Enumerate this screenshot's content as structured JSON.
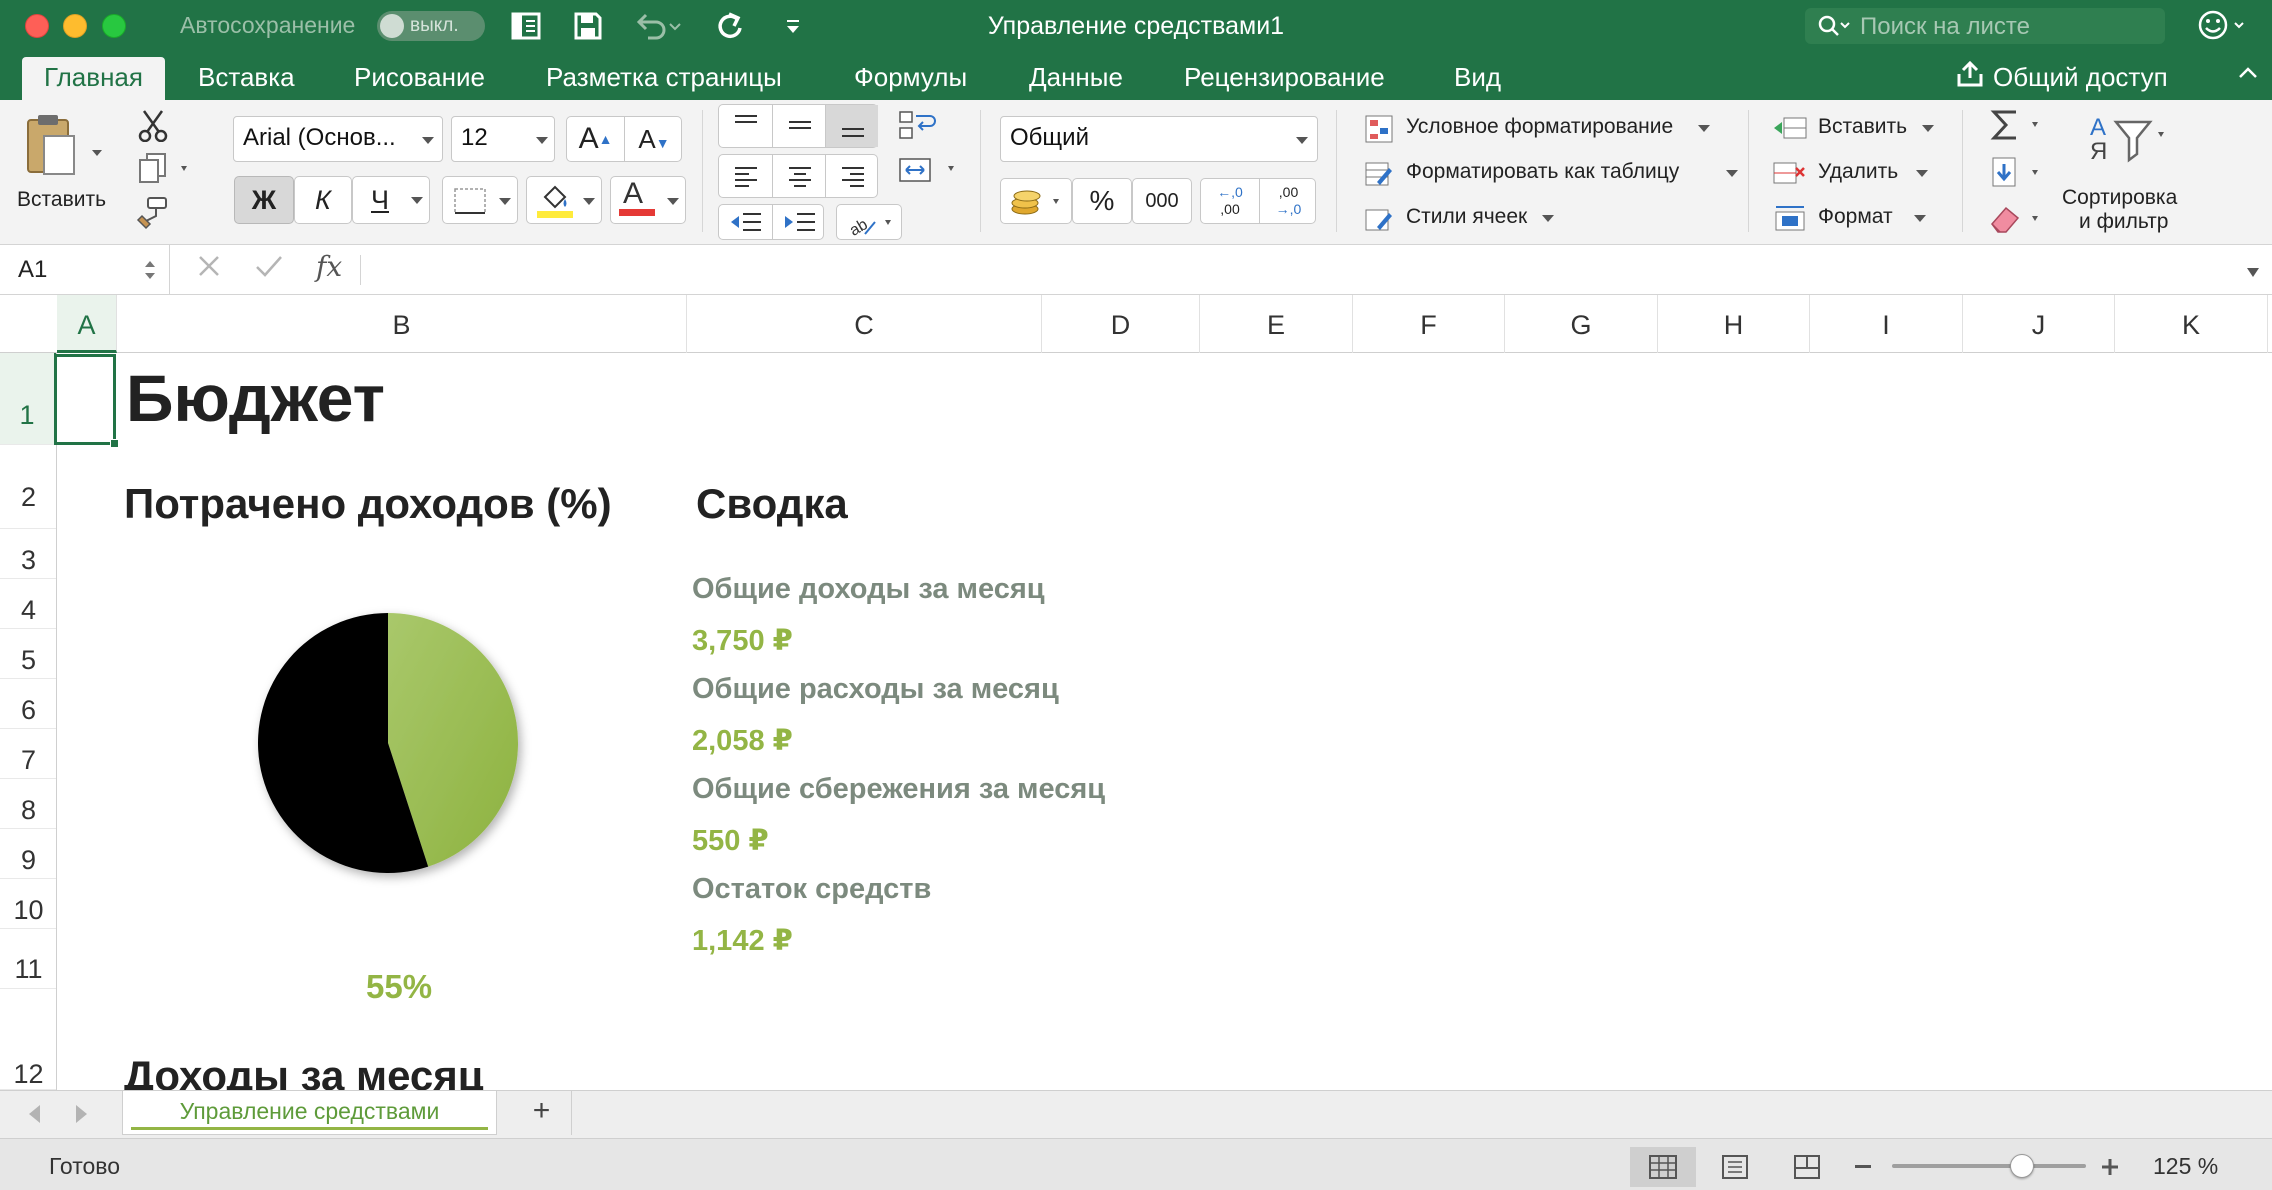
{
  "titlebar": {
    "autosave_label": "Автосохранение",
    "autosave_state": "выкл.",
    "window_title": "Управление средствами1",
    "search_placeholder": "Поиск на листе"
  },
  "ribbon_tabs": [
    "Главная",
    "Вставка",
    "Рисование",
    "Разметка страницы",
    "Формулы",
    "Данные",
    "Рецензирование",
    "Вид"
  ],
  "share_label": "Общий доступ",
  "ribbon": {
    "paste_label": "Вставить",
    "font_name": "Arial (Основ...",
    "font_size": "12",
    "bold_label": "Ж",
    "italic_label": "К",
    "underline_label": "Ч",
    "grow_font": "A",
    "shrink_font": "A",
    "font_color_letter": "A",
    "number_format": "Общий",
    "percent_symbol": "%",
    "thousands_label": "000",
    "dec_increase_top": "←,0",
    "dec_increase_bottom": ",00",
    "dec_decrease_top": ",00",
    "dec_decrease_bottom": "→,0",
    "conditional_formatting": "Условное форматирование",
    "format_as_table": "Форматировать как таблицу",
    "cell_styles": "Стили ячеек",
    "insert_cells": "Вставить",
    "delete_cells": "Удалить",
    "format_cells": "Формат",
    "sort_filter_line1": "Сортировка",
    "sort_filter_line2": "и фильтр",
    "sort_az_top": "А",
    "sort_az_bottom": "Я",
    "highlight_color": "#ffeb3b",
    "font_color": "#e53935"
  },
  "formula_bar": {
    "cell_ref": "A1",
    "fx_label": "fx",
    "formula": ""
  },
  "columns": [
    "A",
    "B",
    "C",
    "D",
    "E",
    "F",
    "G",
    "H",
    "I",
    "J",
    "K"
  ],
  "rows": [
    "1",
    "2",
    "3",
    "4",
    "5",
    "6",
    "7",
    "8",
    "9",
    "10",
    "11",
    "12"
  ],
  "sheet": {
    "title": "Бюджет",
    "spent_heading": "Потрачено доходов (%)",
    "summary_heading": "Сводка",
    "summary": [
      {
        "label": "Общие доходы за месяц",
        "value": "3,750 ₽"
      },
      {
        "label": "Общие расходы за месяц",
        "value": "2,058 ₽"
      },
      {
        "label": "Общие сбережения за месяц",
        "value": "550 ₽"
      },
      {
        "label": "Остаток средств",
        "value": "1,142 ₽"
      }
    ],
    "spent_percent": "55%",
    "income_heading": "Доходы за месяц"
  },
  "chart_data": {
    "type": "pie",
    "values": [
      55,
      45
    ],
    "colors": [
      "#000000",
      "#93b545"
    ],
    "data_label": "55%"
  },
  "sheet_tabs": {
    "active": "Управление средствами",
    "add_label": "+"
  },
  "statusbar": {
    "status": "Готово",
    "zoom_value": 125,
    "zoom_label": "125 %"
  }
}
